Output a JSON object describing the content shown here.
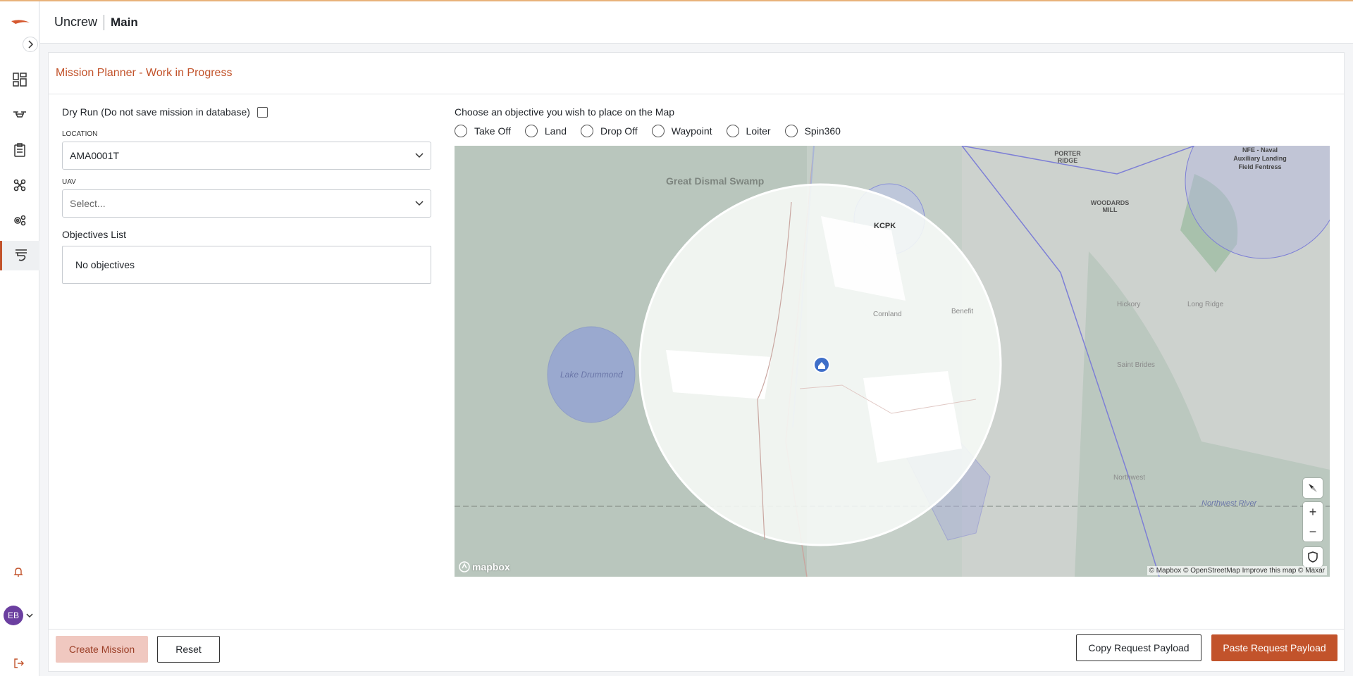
{
  "header": {
    "brand": "Uncrew",
    "crumb": "Main"
  },
  "sidebar": {
    "items": [
      {
        "icon": "dashboard-icon"
      },
      {
        "icon": "drone-icon"
      },
      {
        "icon": "clipboard-icon"
      },
      {
        "icon": "quadcopter-icon"
      },
      {
        "icon": "settings-gears-icon"
      },
      {
        "icon": "mission-planner-icon",
        "active": true
      }
    ],
    "user_initials": "EB"
  },
  "card": {
    "title": "Mission Planner - Work in Progress",
    "dry_run_label": "Dry Run (Do not save mission in database)",
    "location_label": "LOCATION",
    "location_value": "AMA0001T",
    "uav_label": "UAV",
    "uav_placeholder": "Select...",
    "objectives_title": "Objectives List",
    "objectives_empty": "No objectives"
  },
  "objective_picker": {
    "prompt": "Choose an objective you wish to place on the Map",
    "options": [
      "Take Off",
      "Land",
      "Drop Off",
      "Waypoint",
      "Loiter",
      "Spin360"
    ]
  },
  "map": {
    "labels": {
      "swamp": "Great Dismal Swamp",
      "lake": "Lake Drummond",
      "airport": "KCPK",
      "porter": "PORTER RIDGE",
      "woodards": "WOODARDS MILL",
      "nfe": "NFE - Naval Auxiliary Landing Field Fentress",
      "cornland": "Cornland",
      "benefit": "Benefit",
      "long_ridge": "Long Ridge",
      "saint_brides": "Saint Brides",
      "northwest": "Northwest",
      "northwest_river": "Northwest River",
      "hickory": "Hickory"
    },
    "logo_text": "mapbox",
    "attribution": "© Mapbox © OpenStreetMap Improve this map © Maxar"
  },
  "footer": {
    "create_label": "Create Mission",
    "reset_label": "Reset",
    "copy_label": "Copy Request Payload",
    "paste_label": "Paste Request Payload"
  }
}
